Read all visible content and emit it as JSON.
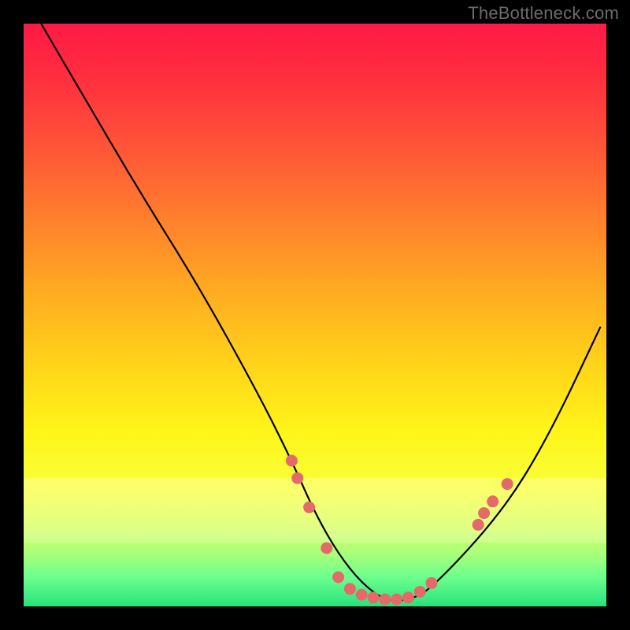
{
  "watermark": "TheBottleneck.com",
  "colors": {
    "gradient_top": "#ff1a46",
    "gradient_bottom": "#28e27a",
    "dot": "#e46a6a",
    "line": "#000000"
  },
  "chart_data": {
    "type": "line",
    "title": "",
    "xlabel": "",
    "ylabel": "",
    "xlim": [
      0,
      100
    ],
    "ylim": [
      0,
      100
    ],
    "x": [
      3,
      10,
      20,
      30,
      40,
      46,
      50,
      54,
      58,
      62,
      66,
      70,
      82,
      90,
      99
    ],
    "values": [
      100,
      88,
      71,
      55,
      37,
      25,
      16,
      9,
      4,
      1,
      1,
      3,
      16,
      29,
      48
    ],
    "pale_band_y_range": [
      11,
      22
    ],
    "series": [
      {
        "name": "bottleneck-curve",
        "x": [
          3,
          10,
          20,
          30,
          40,
          46,
          50,
          54,
          58,
          62,
          66,
          70,
          82,
          90,
          99
        ],
        "values": [
          100,
          88,
          71,
          55,
          37,
          25,
          16,
          9,
          4,
          1,
          1,
          3,
          16,
          29,
          48
        ]
      }
    ],
    "dots": [
      {
        "x": 46,
        "y": 25
      },
      {
        "x": 47,
        "y": 22
      },
      {
        "x": 49,
        "y": 17
      },
      {
        "x": 52,
        "y": 10
      },
      {
        "x": 54,
        "y": 5
      },
      {
        "x": 56,
        "y": 3
      },
      {
        "x": 58,
        "y": 2
      },
      {
        "x": 60,
        "y": 1.5
      },
      {
        "x": 62,
        "y": 1.2
      },
      {
        "x": 64,
        "y": 1.2
      },
      {
        "x": 66,
        "y": 1.5
      },
      {
        "x": 68,
        "y": 2.5
      },
      {
        "x": 70,
        "y": 4
      },
      {
        "x": 78,
        "y": 14
      },
      {
        "x": 79,
        "y": 16
      },
      {
        "x": 80.5,
        "y": 18
      },
      {
        "x": 83,
        "y": 21
      }
    ]
  }
}
